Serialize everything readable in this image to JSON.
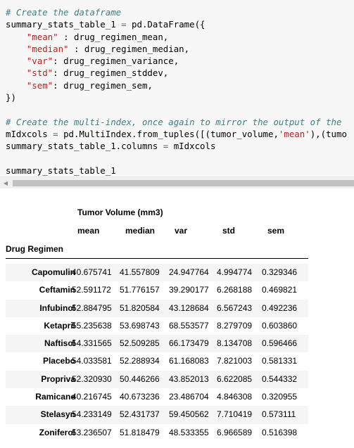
{
  "code": {
    "lines": [
      [
        {
          "t": "comment",
          "v": "# Create the dataframe"
        }
      ],
      [
        {
          "t": "text",
          "v": "summary_stats_table_1 "
        },
        {
          "t": "op",
          "v": "="
        },
        {
          "t": "text",
          "v": " pd.DataFrame({"
        }
      ],
      [
        {
          "t": "text",
          "v": "    "
        },
        {
          "t": "string",
          "v": "\"mean\""
        },
        {
          "t": "text",
          "v": " : drug_regimen_mean,"
        }
      ],
      [
        {
          "t": "text",
          "v": "    "
        },
        {
          "t": "string",
          "v": "\"median\""
        },
        {
          "t": "text",
          "v": " : drug_regimen_median,"
        }
      ],
      [
        {
          "t": "text",
          "v": "    "
        },
        {
          "t": "string",
          "v": "\"var\""
        },
        {
          "t": "text",
          "v": ": drug_regimen_variance,"
        }
      ],
      [
        {
          "t": "text",
          "v": "    "
        },
        {
          "t": "string",
          "v": "\"std\""
        },
        {
          "t": "text",
          "v": ": drug_regimen_stddev,"
        }
      ],
      [
        {
          "t": "text",
          "v": "    "
        },
        {
          "t": "string",
          "v": "\"sem\""
        },
        {
          "t": "text",
          "v": ": drug_regimen_sem,"
        }
      ],
      [
        {
          "t": "text",
          "v": "})"
        }
      ],
      [
        {
          "t": "text",
          "v": ""
        }
      ],
      [
        {
          "t": "comment",
          "v": "# Create the multi-index, once again to mirror the output of the"
        }
      ],
      [
        {
          "t": "text",
          "v": "mIdxcols "
        },
        {
          "t": "op",
          "v": "="
        },
        {
          "t": "text",
          "v": " pd.MultiIndex.from_tuples([(tumor_volume,"
        },
        {
          "t": "string",
          "v": "'mean'"
        },
        {
          "t": "text",
          "v": "),(tumo"
        }
      ],
      [
        {
          "t": "text",
          "v": "summary_stats_table_1.columns "
        },
        {
          "t": "op",
          "v": "="
        },
        {
          "t": "text",
          "v": " mIdxcols"
        }
      ],
      [
        {
          "t": "text",
          "v": ""
        }
      ],
      [
        {
          "t": "text",
          "v": "summary_stats_table_1"
        }
      ]
    ]
  },
  "scrollbar": {
    "left_arrow": "◀"
  },
  "table": {
    "group_header": "Tumor Volume (mm3)",
    "index_name": "Drug Regimen",
    "columns": [
      "mean",
      "median",
      "var",
      "std",
      "sem"
    ],
    "rows": [
      {
        "name": "Capomulin",
        "values": [
          "40.675741",
          "41.557809",
          "24.947764",
          "4.994774",
          "0.329346"
        ]
      },
      {
        "name": "Ceftamin",
        "values": [
          "52.591172",
          "51.776157",
          "39.290177",
          "6.268188",
          "0.469821"
        ]
      },
      {
        "name": "Infubinol",
        "values": [
          "52.884795",
          "51.820584",
          "43.128684",
          "6.567243",
          "0.492236"
        ]
      },
      {
        "name": "Ketapril",
        "values": [
          "55.235638",
          "53.698743",
          "68.553577",
          "8.279709",
          "0.603860"
        ]
      },
      {
        "name": "Naftisol",
        "values": [
          "54.331565",
          "52.509285",
          "66.173479",
          "8.134708",
          "0.596466"
        ]
      },
      {
        "name": "Placebo",
        "values": [
          "54.033581",
          "52.288934",
          "61.168083",
          "7.821003",
          "0.581331"
        ]
      },
      {
        "name": "Propriva",
        "values": [
          "52.320930",
          "50.446266",
          "43.852013",
          "6.622085",
          "0.544332"
        ]
      },
      {
        "name": "Ramicane",
        "values": [
          "40.216745",
          "40.673236",
          "23.486704",
          "4.846308",
          "0.320955"
        ]
      },
      {
        "name": "Stelasyn",
        "values": [
          "54.233149",
          "52.431737",
          "59.450562",
          "7.710419",
          "0.573111"
        ]
      },
      {
        "name": "Zoniferol",
        "values": [
          "53.236507",
          "51.818479",
          "48.533355",
          "6.966589",
          "0.516398"
        ]
      }
    ]
  }
}
